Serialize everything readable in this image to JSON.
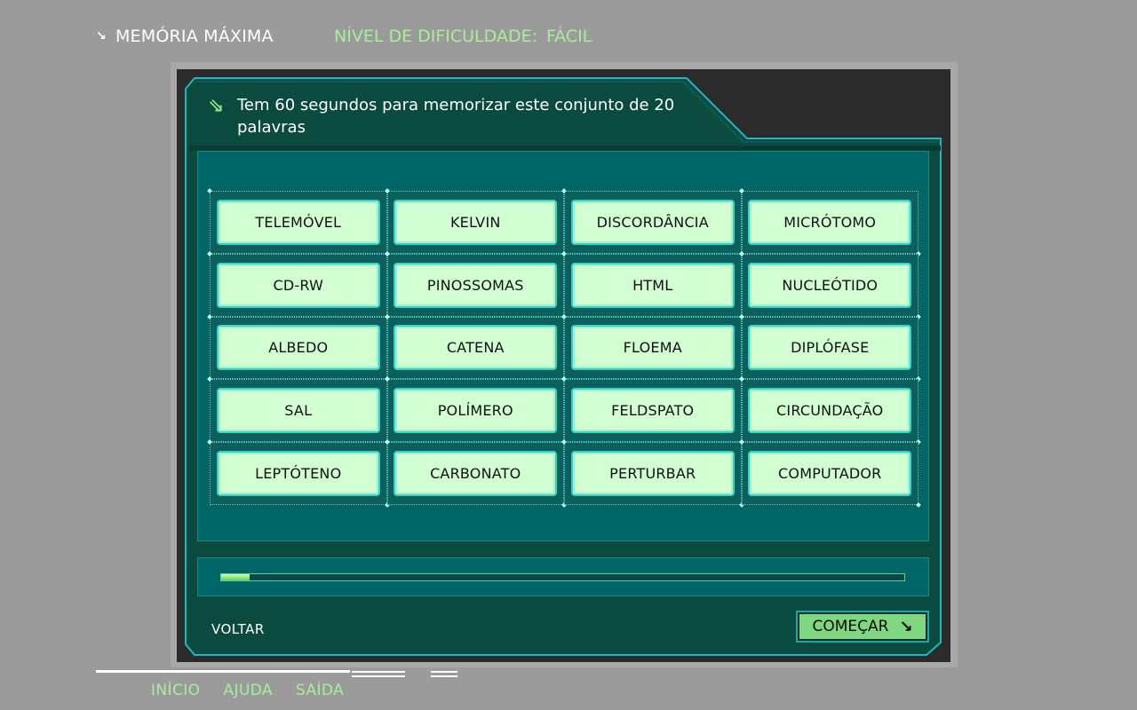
{
  "header": {
    "app_title": "MEMÓRIA MÁXIMA",
    "app_title_icon": "arrow-down-right-icon",
    "difficulty_label": "NÍVEL DE DIFICULDADE:",
    "difficulty_value": "FÁCIL"
  },
  "panel": {
    "instruction_icon": "double-arrow-down-right-icon",
    "instruction": "Tem 60 segundos para memorizar este conjunto de 20 palavras",
    "words": [
      "TELEMÓVEL",
      "KELVIN",
      "DISCORDÂNCIA",
      "MICRÓTOMO",
      "CD-RW",
      "PINOSSOMAS",
      "HTML",
      "NUCLEÓTIDO",
      "ALBEDO",
      "CATENA",
      "FLOEMA",
      "DIPLÓFASE",
      "SAL",
      "POLÍMERO",
      "FELDSPATO",
      "CIRCUNDAÇÃO",
      "LEPTÓTENO",
      "CARBONATO",
      "PERTURBAR",
      "COMPUTADOR"
    ],
    "timer_progress": 0.042,
    "back_label": "VOLTAR",
    "start_label": "COMEÇAR",
    "start_icon": "arrow-down-right-icon"
  },
  "nav": {
    "home": "INÍCIO",
    "help": "AJUDA",
    "exit": "SAÍDA"
  },
  "colors": {
    "panel_teal": "#005f5f",
    "accent_green": "#a8ee9a",
    "word_bg": "#d2ffd2",
    "button_green": "#7fd87f"
  }
}
